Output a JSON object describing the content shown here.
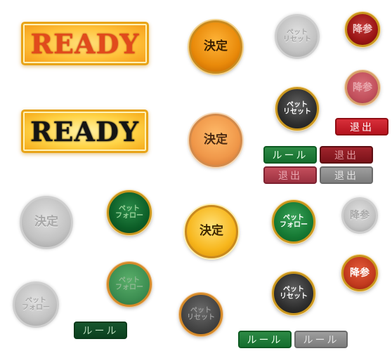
{
  "ready_banners": {
    "ready_orange": "READY",
    "ready_dark": "READY"
  },
  "buttons": {
    "kettei_orange": "決定",
    "kettei_orange_pale": "決定",
    "kettei_grey": "決定",
    "kettei_gold": "決定",
    "pet_reset_grey_top": "ペット\nリセット",
    "pet_reset_dark": "ペット\nリセット",
    "pet_reset_dark_2": "ペット\nリセット",
    "pet_reset_dark_3": "ペット\nリセット",
    "pet_follow_green": "ペット\nフォロー",
    "pet_follow_green_2": "ペット\nフォロー",
    "pet_follow_green_3": "ペット\nフォロー",
    "pet_follow_grey": "ペット\nフォロー",
    "kousan_red": "降参",
    "kousan_pink": "降参",
    "kousan_grey": "降参",
    "kousan_red_2": "降参"
  },
  "pills": {
    "taishutsu_red": "退出",
    "taishutsu_red_dark": "退出",
    "taishutsu_rose": "退出",
    "taishutsu_grey": "退出",
    "rule_green": "ルール",
    "rule_green_dark": "ルール",
    "rule_green_2": "ルール",
    "rule_grey": "ルール"
  },
  "colors": {
    "orange": "#e98a0a",
    "gold": "#f7b71e",
    "green": "#167a34",
    "red": "#9a1515",
    "grey": "#c2c2c2",
    "dark": "#2f2f2f"
  }
}
